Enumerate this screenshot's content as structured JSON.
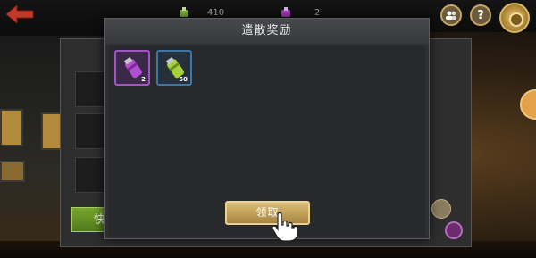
{
  "top_bar": {
    "resource_1": {
      "icon": "green-canister-icon",
      "value": "410"
    },
    "resource_2": {
      "icon": "purple-canister-icon",
      "value": "2"
    },
    "help_label": "?"
  },
  "dialog": {
    "title": "遣散奖励",
    "items": [
      {
        "icon": "purple-canister-icon",
        "count": "2",
        "rarity_color": "#a553c8"
      },
      {
        "icon": "green-canister-icon",
        "count": "50",
        "rarity_color": "#3c77a6"
      }
    ],
    "claim_label": "领取"
  },
  "background_panel": {
    "green_button_label": "快"
  },
  "colors": {
    "accent_gold": "#d9bd75",
    "dialog_bg": "#2d2f33",
    "purple_rarity": "#a553c8",
    "blue_rarity": "#3c77a6"
  }
}
